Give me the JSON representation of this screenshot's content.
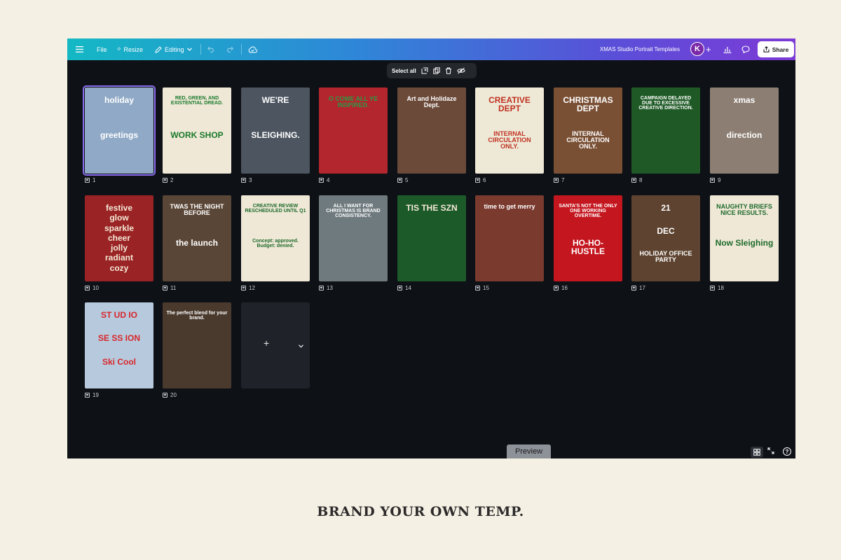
{
  "toolbar": {
    "file_label": "File",
    "resize_label": "Resize",
    "editing_label": "Editing",
    "doc_title": "XMAS Studio Portrait Templates",
    "avatar_initial": "K",
    "share_label": "Share"
  },
  "selection_bar": {
    "select_all_label": "Select all"
  },
  "pages": [
    {
      "number": "1",
      "bg": "#8fa9c6",
      "texts": [
        "holiday",
        "greetings"
      ]
    },
    {
      "number": "2",
      "bg": "#efe8d6",
      "texts": [
        "RED, GREEN, AND EXISTENTIAL DREAD.",
        "WORK SHOP"
      ]
    },
    {
      "number": "3",
      "bg": "#4c5560",
      "texts": [
        "WE'RE",
        "SLEIGHING."
      ]
    },
    {
      "number": "4",
      "bg": "#b3262d",
      "texts": [
        "O COME ALL YE INSPIRED."
      ]
    },
    {
      "number": "5",
      "bg": "#6b4a3a",
      "texts": [
        "Art and Holidaze Dept."
      ]
    },
    {
      "number": "6",
      "bg": "#eee9d7",
      "texts": [
        "CREATIVE DEPT",
        "INTERNAL CIRCULATION ONLY."
      ]
    },
    {
      "number": "7",
      "bg": "#7a5035",
      "texts": [
        "CHRISTMAS DEPT",
        "INTERNAL CIRCULATION ONLY."
      ]
    },
    {
      "number": "8",
      "bg": "#1f5a26",
      "texts": [
        "CAMPAIGN DELAYED DUE TO EXCESSIVE CREATIVE DIRECTION."
      ]
    },
    {
      "number": "9",
      "bg": "#8c7e72",
      "texts": [
        "xmas",
        "direction"
      ]
    },
    {
      "number": "10",
      "bg": "#9a2325",
      "texts": [
        "festive",
        "glow",
        "sparkle",
        "cheer",
        "jolly",
        "radiant",
        "cozy"
      ]
    },
    {
      "number": "11",
      "bg": "#5a4636",
      "texts": [
        "TWAS THE NIGHT BEFORE",
        "the launch"
      ]
    },
    {
      "number": "12",
      "bg": "#efe8d6",
      "texts": [
        "CREATIVE REVIEW RESCHEDULED UNTIL Q1",
        "Concept: approved. Budget: denied."
      ]
    },
    {
      "number": "13",
      "bg": "#6f7a7e",
      "texts": [
        "ALL I WANT FOR CHRISTMAS IS BRAND CONSISTENCY."
      ]
    },
    {
      "number": "14",
      "bg": "#1d5a2a",
      "texts": [
        "TIS THE SZN"
      ]
    },
    {
      "number": "15",
      "bg": "#7a3a2e",
      "texts": [
        "time to get merry"
      ]
    },
    {
      "number": "16",
      "bg": "#c4161e",
      "texts": [
        "SANTA'S NOT THE ONLY ONE WORKING OVERTIME.",
        "HO-HO-HUSTLE"
      ]
    },
    {
      "number": "17",
      "bg": "#5e4430",
      "texts": [
        "21",
        "DEC",
        "HOLIDAY OFFICE PARTY"
      ]
    },
    {
      "number": "18",
      "bg": "#efe8d6",
      "texts": [
        "NAUGHTY BRIEFS NICE RESULTS.",
        "Now Sleighing"
      ]
    },
    {
      "number": "19",
      "bg": "#b7c9dc",
      "texts": [
        "ST UD IO",
        "SE SS ION",
        "Ski Cool"
      ]
    },
    {
      "number": "20",
      "bg": "#4a3a2e",
      "texts": [
        "The perfect blend for your brand."
      ]
    }
  ],
  "add_page": {
    "plus": "+"
  },
  "footer": {
    "preview_label": "Preview",
    "help": "?"
  },
  "tagline": "BRAND YOUR OWN TEMP.",
  "colors": {
    "accent": "#8a6cf0",
    "canvas": "#0e1116",
    "page_bg": "#f4f0e4"
  }
}
